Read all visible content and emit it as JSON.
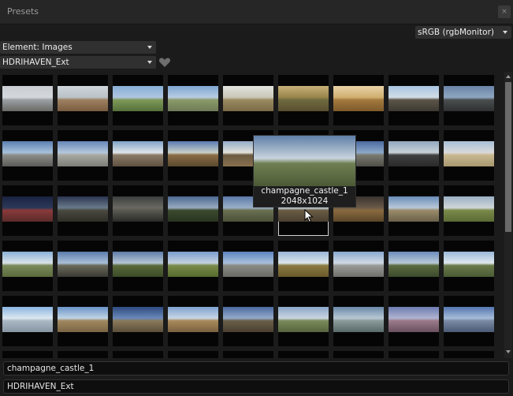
{
  "window": {
    "title": "Presets",
    "close_glyph": "×"
  },
  "color_profile": {
    "value": "sRGB (rgbMonitor)"
  },
  "element_dropdown": {
    "value": "Element: Images"
  },
  "collection_dropdown": {
    "value": "HDRIHAVEN_Ext"
  },
  "favorite_icon": "heart-icon",
  "tooltip": {
    "name": "champagne_castle_1",
    "resolution": "2048x1024"
  },
  "fields": {
    "preset_name": "champagne_castle_1",
    "collection_name": "HDRIHAVEN_Ext"
  },
  "colors": {
    "accent_selected": "#d0d0d0",
    "background": "#1b1b1b"
  },
  "thumbnails": [
    [
      "#c8cdd3",
      "#d4d8dc",
      "#9aa0a4",
      "#6a6a66"
    ],
    [
      "#cfd6dc",
      "#b9c2c7",
      "#9d8060",
      "#7a5c40"
    ],
    [
      "#88aed6",
      "#aec6e0",
      "#7e9958",
      "#55703a"
    ],
    [
      "#7ea6d2",
      "#b8cce2",
      "#8a9a6a",
      "#6f7b55"
    ],
    [
      "#e2e4de",
      "#c9c6b6",
      "#9a8a60",
      "#7a6a48"
    ],
    [
      "#c8b078",
      "#98844a",
      "#6e6a3e",
      "#5a4f30"
    ],
    [
      "#e8d2a8",
      "#d0b070",
      "#a47a3e",
      "#7c5a2a"
    ],
    [
      "#a8c4e0",
      "#d2dde6",
      "#5c5448",
      "#3c3a32"
    ],
    [
      "#6a84a8",
      "#8ea6c0",
      "#4a4e4e",
      "#2e3032"
    ],
    [
      "#5a7fb0",
      "#a7c1dc",
      "#8c8c88",
      "#5a5a58"
    ],
    [
      "#6686b8",
      "#b4c8dc",
      "#a8a8a2",
      "#7c7c78"
    ],
    [
      "#80a2c8",
      "#e0e6ea",
      "#8a7a66",
      "#5e5040"
    ],
    [
      "#5a7ab2",
      "#c8d0c8",
      "#8a6a44",
      "#5a4a30"
    ],
    [
      "#94adc8",
      "#e2e2da",
      "#6a5a40",
      "#8a7050"
    ],
    [
      "#6c90b6",
      "#c6d2dc",
      "#8a8878",
      "#606050"
    ],
    [
      "#4a6aa0",
      "#8ca8c8",
      "#7a7a70",
      "#4e4e48"
    ],
    [
      "#90a8c0",
      "#c8d2d8",
      "#404040",
      "#2a2a2a"
    ],
    [
      "#a8c0d8",
      "#dadada",
      "#c8b890",
      "#a89870"
    ],
    [
      "#1a2240",
      "#2c3858",
      "#8a3a3a",
      "#5a2a2a"
    ],
    [
      "#2a3450",
      "#6a7a8a",
      "#4a4a40",
      "#2e2e28"
    ],
    [
      "#3a3e3e",
      "#6a6a62",
      "#5a5a52",
      "#2a2a28"
    ],
    [
      "#4a6890",
      "#98aac0",
      "#3a4a2e",
      "#2a3420"
    ],
    [
      "#5a78a8",
      "#9ab0c8",
      "#6a7050",
      "#4a5038"
    ],
    [
      "#8aa4c4",
      "#c4d0dc",
      "#6a5c44",
      "#4a4030"
    ],
    [
      "#3a3430",
      "#6a5a48",
      "#8a6a40",
      "#5a4528"
    ],
    [
      "#6a8cb8",
      "#b8c8d8",
      "#9a8c6a",
      "#6a604a"
    ],
    [
      "#9ab0c4",
      "#d0d6d8",
      "#7a8a4a",
      "#5a6a34"
    ],
    [
      "#8ab0d8",
      "#dae4ea",
      "#7a8a5a",
      "#5a6a3c"
    ],
    [
      "#5a7cae",
      "#aac0d8",
      "#6a6a5a",
      "#3a3a34"
    ],
    [
      "#5e7ca8",
      "#b6c6d6",
      "#5a6a3a",
      "#3a4a28"
    ],
    [
      "#7a9ccc",
      "#c4d2e0",
      "#7a8a4a",
      "#556a2c"
    ],
    [
      "#5c84c0",
      "#a8c0dc",
      "#8a8a84",
      "#6a6a66"
    ],
    [
      "#9ab6d6",
      "#dce6ec",
      "#8a7a40",
      "#6a5a2c"
    ],
    [
      "#88a8d0",
      "#d0dae4",
      "#9a9a96",
      "#6e6e6a"
    ],
    [
      "#6c8cbc",
      "#b8cad8",
      "#5a6a40",
      "#3c4a2c"
    ],
    [
      "#9ab8d8",
      "#e0e8ee",
      "#6a7a4a",
      "#4a5a34"
    ],
    [
      "#8ab4e0",
      "#dce8f0",
      "#aab8c4",
      "#8896a4"
    ],
    [
      "#6a92c8",
      "#c0d4e4",
      "#a08860",
      "#7a6444"
    ],
    [
      "#2e4a80",
      "#6a88b8",
      "#8a7a5a",
      "#5a4e3a"
    ],
    [
      "#7ea2d0",
      "#c8d6e4",
      "#a88a5a",
      "#7a6040"
    ],
    [
      "#4a6aa0",
      "#94aac8",
      "#6a5e48",
      "#4a4030"
    ],
    [
      "#8aa6c8",
      "#cad6e0",
      "#7a8a5a",
      "#56643e"
    ],
    [
      "#6a88a8",
      "#b8c8d4",
      "#8a9a9a",
      "#5a6a6a"
    ],
    [
      "#6c7cb0",
      "#b0b4d0",
      "#9a7a8a",
      "#6a5060"
    ],
    [
      "#5474b0",
      "#a6bcd8",
      "#7a8aa4",
      "#4a5a74"
    ],
    [
      "#3a5a90",
      "#7a9ac0",
      "#4a4a44",
      "#2a2a28"
    ],
    [
      "#7a9ac8",
      "#c0d0e0",
      "#6a6a58",
      "#44443a"
    ],
    [
      "#9ab0c8",
      "#d0dae2",
      "#8a8270",
      "#5e5848"
    ],
    [
      "#6a8ab8",
      "#b4c4d6",
      "#7a6a4a",
      "#5a4a34"
    ],
    [
      "#4a6a98",
      "#8aa4c0",
      "#5a5a4a",
      "#3a3a30"
    ],
    [
      "#88a4c4",
      "#c4d0dc",
      "#6a7a4a",
      "#4a5634"
    ],
    [
      "#5a7aa8",
      "#a0b6cc",
      "#6a6a60",
      "#4a4a42"
    ],
    [
      "#7a96c0",
      "#c0ccda",
      "#8a7a5a",
      "#605440"
    ],
    [
      "#9ab2d0",
      "#d4dce6",
      "#7a7a6a",
      "#56564a"
    ]
  ],
  "tooltip_thumb": [
    "#5f7fa8",
    "#c8d4dc",
    "#6f7f52",
    "#4b5a36"
  ]
}
